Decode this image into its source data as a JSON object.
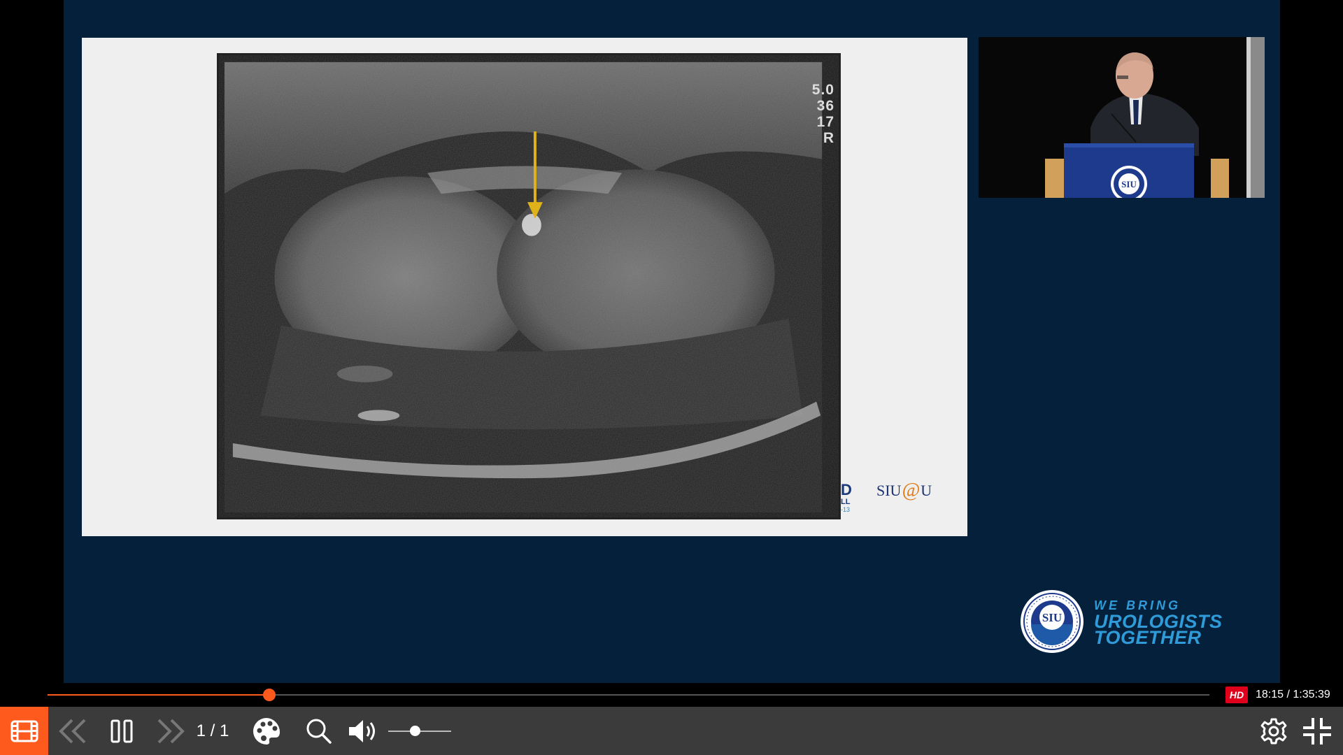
{
  "slide": {
    "ultrasound_readout": [
      "5.0",
      "36",
      "17",
      "R"
    ],
    "partial_logo_chars": {
      "big": "D",
      "mid": "LL",
      "small": "-13"
    },
    "siu_u_logo": {
      "left": "SIU",
      "at": "@",
      "right": "U"
    }
  },
  "speaker_video": {
    "podium_seal_text": "SIU"
  },
  "branding": {
    "seal_text": "SIU",
    "tagline_line1": "WE BRING",
    "tagline_line2": "UROLOGISTS",
    "tagline_line3": "TOGETHER"
  },
  "player": {
    "progress": 0.191,
    "hd_label": "HD",
    "time_display": "18:15 / 1:35:39",
    "page_indicator": "1 / 1",
    "volume_level": 0.42,
    "accent_color": "#ff5a1e",
    "icons": [
      "film-icon",
      "previous-icon",
      "pause-icon",
      "next-icon",
      "palette-icon",
      "search-icon",
      "volume-icon",
      "settings-icon",
      "exit-fullscreen-icon"
    ]
  }
}
